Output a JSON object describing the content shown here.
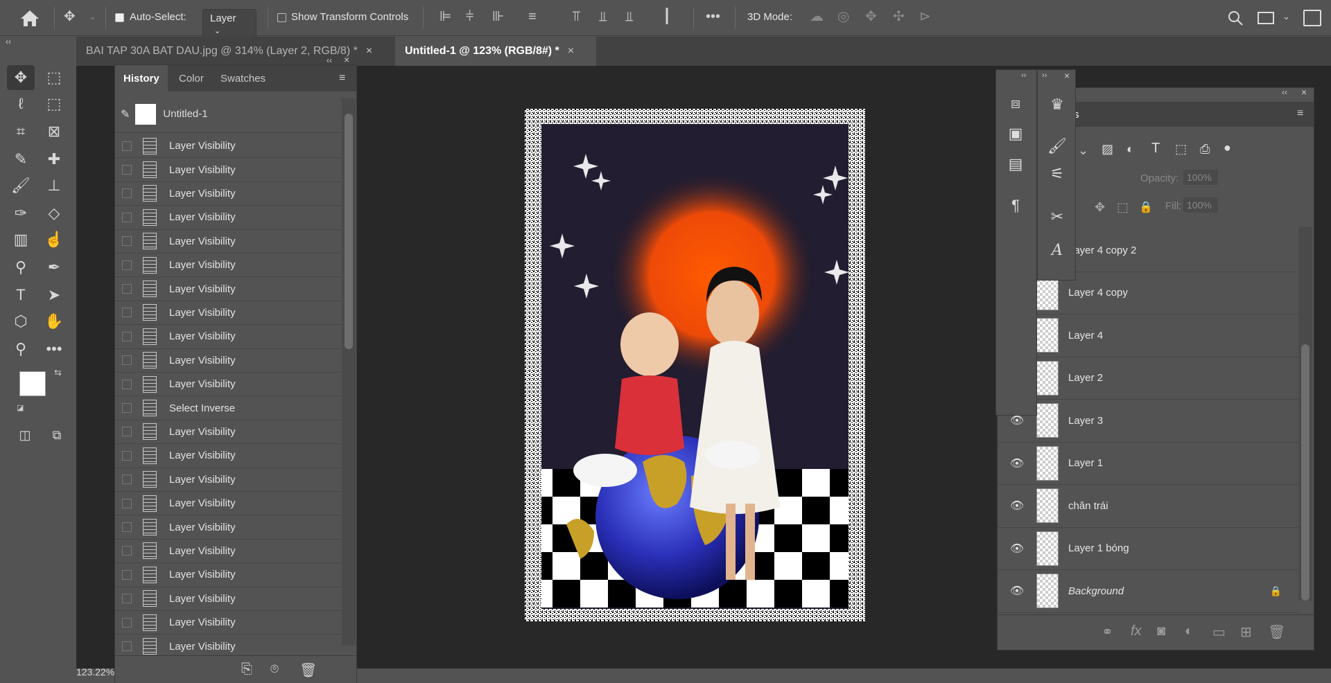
{
  "optbar": {
    "auto_select_label": "Auto-Select:",
    "auto_select_value": "Layer",
    "show_transform_label": "Show Transform Controls",
    "mode_3d_label": "3D Mode:"
  },
  "tabs": [
    {
      "label": "BAI TAP 30A BAT DAU.jpg @ 314% (Layer 2, RGB/8) *",
      "close": "×"
    },
    {
      "label": "Untitled-1 @ 123% (RGB/8#) *",
      "close": "×"
    }
  ],
  "history": {
    "tabs": [
      "History",
      "Color",
      "Swatches"
    ],
    "snapshot_name": "Untitled-1",
    "items": [
      "Layer Visibility",
      "Layer Visibility",
      "Layer Visibility",
      "Layer Visibility",
      "Layer Visibility",
      "Layer Visibility",
      "Layer Visibility",
      "Layer Visibility",
      "Layer Visibility",
      "Layer Visibility",
      "Layer Visibility",
      "Select Inverse",
      "Layer Visibility",
      "Layer Visibility",
      "Layer Visibility",
      "Layer Visibility",
      "Layer Visibility",
      "Layer Visibility",
      "Layer Visibility",
      "Layer Visibility",
      "Layer Visibility",
      "Layer Visibility"
    ]
  },
  "layers": {
    "tab_fragment": "s",
    "opacity_label": "Opacity:",
    "opacity_value": "100%",
    "fill_label": "Fill:",
    "fill_value": "100%",
    "items": [
      {
        "name": "Layer 4 copy 2",
        "italic": false,
        "locked": false
      },
      {
        "name": "Layer 4 copy",
        "italic": false,
        "locked": false
      },
      {
        "name": "Layer 4",
        "italic": false,
        "locked": false
      },
      {
        "name": "Layer 2",
        "italic": false,
        "locked": false
      },
      {
        "name": "Layer 3",
        "italic": false,
        "locked": false
      },
      {
        "name": "Layer 1",
        "italic": false,
        "locked": false
      },
      {
        "name": "chân trái",
        "italic": false,
        "locked": false
      },
      {
        "name": "Layer 1 bóng",
        "italic": false,
        "locked": false
      },
      {
        "name": "Background",
        "italic": true,
        "locked": true
      }
    ]
  },
  "status": {
    "zoom": "123.22%"
  },
  "colors": {
    "foreground": "#ffffff",
    "background": "#000000"
  }
}
